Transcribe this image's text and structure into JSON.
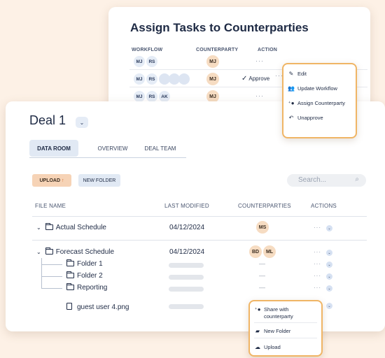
{
  "assign": {
    "title": "Assign Tasks to Counterparties",
    "headers": {
      "workflow": "WORKFLOW",
      "counterparty": "COUNTERPARTY",
      "action": "ACTION"
    },
    "rows": [
      {
        "workflow": [
          "MJ",
          "RS"
        ],
        "counterparty": "MJ",
        "action": "···"
      },
      {
        "workflow": [
          "MJ",
          "RS"
        ],
        "counterparty": "MJ",
        "action_label": "Approve",
        "action": "···"
      },
      {
        "workflow": [
          "MJ",
          "RS",
          "AK"
        ],
        "counterparty": "MJ",
        "action": "···"
      }
    ]
  },
  "action_menu": {
    "items": [
      {
        "label": "Edit",
        "icon": "pencil-icon"
      },
      {
        "label": "Update Workflow",
        "icon": "users-icon"
      },
      {
        "label": "Assign Counterparty",
        "icon": "add-user-icon"
      },
      {
        "label": "Unapprove",
        "icon": "undo-icon"
      }
    ]
  },
  "deal": {
    "title": "Deal 1",
    "tabs": [
      "DATA ROOM",
      "OVERVIEW",
      "DEAL TEAM"
    ],
    "active_tab": "DATA ROOM",
    "upload_label": "UPLOAD",
    "upload_icon": "↑",
    "new_folder_label": "NEW FOLDER",
    "search_placeholder": "Search...",
    "columns": {
      "file_name": "FILE NAME",
      "last_modified": "LAST MODIFIED",
      "counterparties": "COUNTERPARTIES",
      "actions": "ACTIONS"
    },
    "rows": [
      {
        "name": "Actual Schedule",
        "date": "04/12/2024",
        "counterparties": [
          "MS"
        ]
      },
      {
        "name": "Forecast Schedule",
        "date": "04/12/2024",
        "counterparties": [
          "BD",
          "ML"
        ]
      }
    ],
    "subfolders": [
      "Folder 1",
      "Folder 2",
      "Reporting"
    ],
    "file": {
      "name": "guest user 4.png"
    },
    "dash": "—",
    "dots": "···"
  },
  "file_menu": {
    "items": [
      {
        "label": "Share with counterparty",
        "icon": "share-user-icon"
      },
      {
        "label": "New Folder",
        "icon": "new-folder-icon"
      },
      {
        "label": "Upload",
        "icon": "upload-cloud-icon"
      }
    ]
  },
  "colors": {
    "background": "#fdf1e6",
    "accent_orange": "#f0b565",
    "chip_blue": "#e5ecf6",
    "chip_orange": "#f6dcc2"
  }
}
